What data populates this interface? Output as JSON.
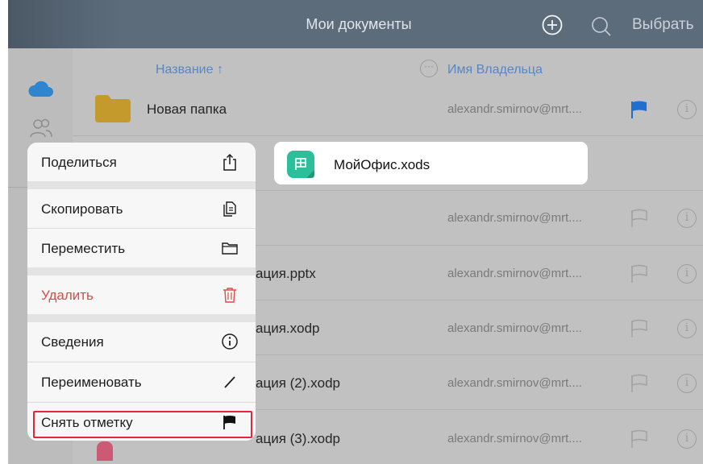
{
  "header": {
    "title": "Мои документы",
    "select_label": "Выбрать",
    "plus_icon": "plus-circle-icon",
    "search_icon": "search-icon"
  },
  "sidebar": {
    "items": [
      {
        "icon": "cloud-icon",
        "color": "#2f86cf"
      },
      {
        "icon": "users-icon"
      }
    ]
  },
  "columns": {
    "name": "Название ↑",
    "more": "···",
    "owner": "Имя Владельца"
  },
  "rows": [
    {
      "name": "Новая папка",
      "owner": "alexandr.smirnov@mrt....",
      "flagged": true
    },
    {
      "name": "",
      "owner": "alexandr.smirnov@mrt....",
      "flagged": false
    },
    {
      "name": "ация.pptx",
      "owner": "alexandr.smirnov@mrt....",
      "flagged": false
    },
    {
      "name": "ация.xodp",
      "owner": "alexandr.smirnov@mrt....",
      "flagged": false
    },
    {
      "name": "ация (2).xodp",
      "owner": "alexandr.smirnov@mrt....",
      "flagged": false
    },
    {
      "name": "ация (3).xodp",
      "owner": "alexandr.smirnov@mrt....",
      "flagged": false
    }
  ],
  "file_card": {
    "name": "МойОфис.xods",
    "icon": "spreadsheet-icon",
    "color": "#2dbf9a"
  },
  "context_menu": {
    "share": "Поделиться",
    "copy": "Скопировать",
    "move": "Переместить",
    "delete": "Удалить",
    "details": "Сведения",
    "rename": "Переименовать",
    "unflag": "Снять отметку"
  },
  "colors": {
    "accent": "#5a86c0",
    "danger": "#e04a42",
    "flag_active": "#1f6fcf",
    "highlight": "#e0273b"
  }
}
